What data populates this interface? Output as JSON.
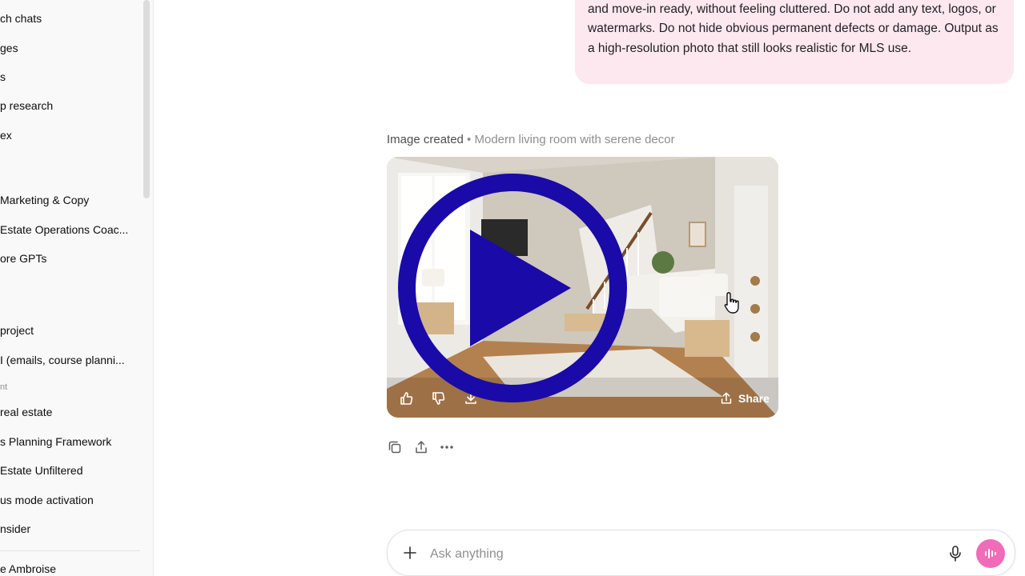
{
  "sidebar": {
    "top_items": [
      {
        "label": "ch chats",
        "icon": "search-icon"
      },
      {
        "label": "ges",
        "icon": "images-icon"
      },
      {
        "label": "s",
        "icon": "apps-icon"
      },
      {
        "label": "p research",
        "icon": "deep-research-icon"
      },
      {
        "label": "ex",
        "icon": "codex-icon"
      }
    ],
    "gpts": [
      {
        "label": "Marketing & Copy"
      },
      {
        "label": "Estate Operations Coac..."
      },
      {
        "label": "ore GPTs"
      }
    ],
    "projects": [
      {
        "label": " project"
      },
      {
        "label": "I (emails, course planni..."
      }
    ],
    "section_label": "nt",
    "chats": [
      {
        "label": " real estate"
      },
      {
        "label": "s Planning Framework"
      },
      {
        "label": " Estate Unfiltered"
      },
      {
        "label": "us mode activation"
      },
      {
        "label": "nsider"
      }
    ],
    "user_name": "e Ambroise"
  },
  "conversation": {
    "user_message": "and move-in ready, without feeling cluttered. Do not add any text, logos, or watermarks.  Do not hide obvious permanent defects or damage.  Output as a high-resolution photo that still looks realistic for MLS use.",
    "image_header": {
      "status": "Image created",
      "separator": " • ",
      "title": "Modern living room with serene decor"
    },
    "image_actions": {
      "share_label": "Share"
    }
  },
  "composer": {
    "placeholder": "Ask anything"
  },
  "colors": {
    "user_bubble": "#fde8f0",
    "play_overlay": "#1a0aa8",
    "voice_button": "#f06bb8"
  }
}
